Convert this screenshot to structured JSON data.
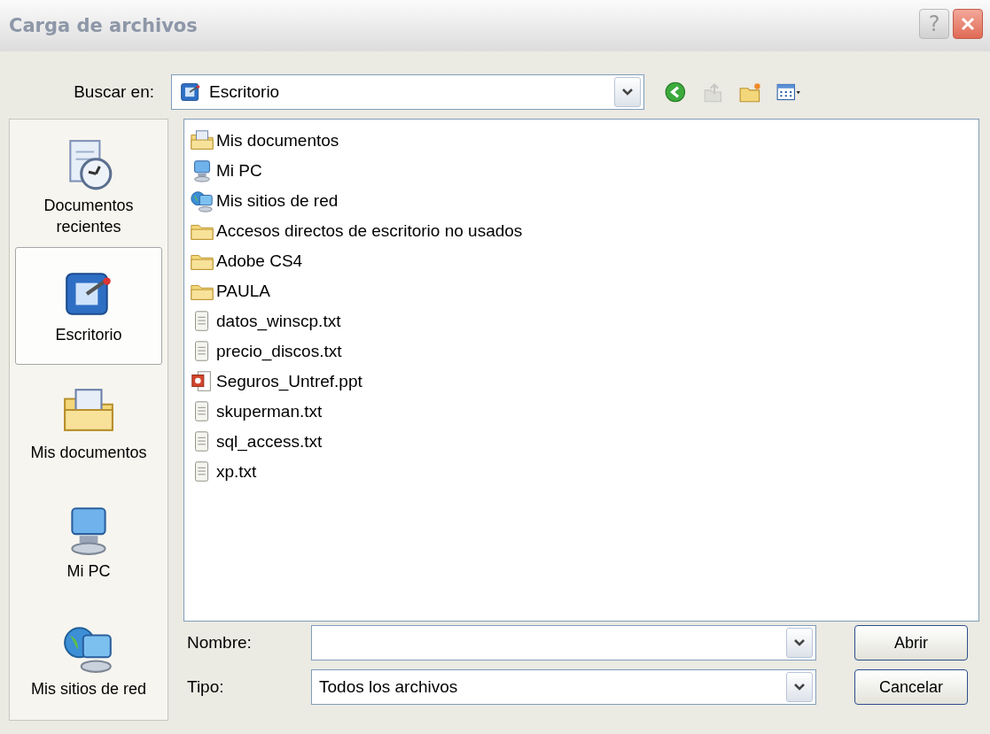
{
  "window": {
    "title": "Carga de archivos"
  },
  "title_buttons": [
    {
      "kind": "help",
      "label": "?"
    },
    {
      "kind": "close"
    }
  ],
  "look_in": {
    "label": "Buscar en:",
    "value": "Escritorio"
  },
  "toolbar": [
    {
      "kind": "back",
      "disabled": false
    },
    {
      "kind": "up",
      "disabled": true
    },
    {
      "kind": "new-folder",
      "disabled": false
    },
    {
      "kind": "views",
      "disabled": false
    }
  ],
  "places": [
    {
      "label": "Documentos recientes",
      "kind": "recent",
      "selected": false
    },
    {
      "label": "Escritorio",
      "kind": "desktop",
      "selected": true
    },
    {
      "label": "Mis documentos",
      "kind": "mydocs",
      "selected": false
    },
    {
      "label": "Mi PC",
      "kind": "pc",
      "selected": false
    },
    {
      "label": "Mis sitios de red",
      "kind": "network",
      "selected": false
    }
  ],
  "files": [
    {
      "name": "Mis documentos",
      "kind": "mydocs"
    },
    {
      "name": "Mi PC",
      "kind": "pc"
    },
    {
      "name": "Mis sitios de red",
      "kind": "network"
    },
    {
      "name": "Accesos directos de escritorio no usados",
      "kind": "folder"
    },
    {
      "name": "Adobe CS4",
      "kind": "folder"
    },
    {
      "name": "PAULA",
      "kind": "folder"
    },
    {
      "name": "datos_winscp.txt",
      "kind": "text"
    },
    {
      "name": "precio_discos.txt",
      "kind": "text"
    },
    {
      "name": "Seguros_Untref.ppt",
      "kind": "ppt"
    },
    {
      "name": "skuperman.txt",
      "kind": "text"
    },
    {
      "name": "sql_access.txt",
      "kind": "text"
    },
    {
      "name": "xp.txt",
      "kind": "text"
    }
  ],
  "name_field": {
    "label": "Nombre:"
  },
  "type_field": {
    "label": "Tipo:",
    "value": "Todos los archivos"
  },
  "buttons": [
    "Abrir",
    "Cancelar"
  ]
}
